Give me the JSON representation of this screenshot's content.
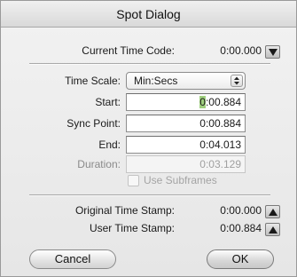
{
  "window": {
    "title": "Spot Dialog"
  },
  "current_time_code": {
    "label": "Current Time Code:",
    "value": "0:00.000"
  },
  "time_scale": {
    "label": "Time Scale:",
    "selected": "Min:Secs"
  },
  "fields": {
    "start": {
      "label": "Start:",
      "value_highlight": "0",
      "value_rest": ":00.884"
    },
    "sync_point": {
      "label": "Sync Point:",
      "value": "0:00.884"
    },
    "end": {
      "label": "End:",
      "value": "0:04.013"
    },
    "duration": {
      "label": "Duration:",
      "value": "0:03.129"
    }
  },
  "use_subframes": {
    "label": "Use Subframes",
    "checked": false,
    "enabled": false
  },
  "original_time_stamp": {
    "label": "Original Time Stamp:",
    "value": "0:00.000"
  },
  "user_time_stamp": {
    "label": "User Time Stamp:",
    "value": "0:00.884"
  },
  "buttons": {
    "cancel": "Cancel",
    "ok": "OK"
  },
  "icons": {
    "current_time_code_arrow": "arrow-down-icon",
    "original_time_stamp_arrow": "arrow-up-icon",
    "user_time_stamp_arrow": "arrow-up-icon",
    "time_scale_stepper": "updown-stepper-icon"
  },
  "colors": {
    "start_highlight": "#9fcf7e"
  }
}
